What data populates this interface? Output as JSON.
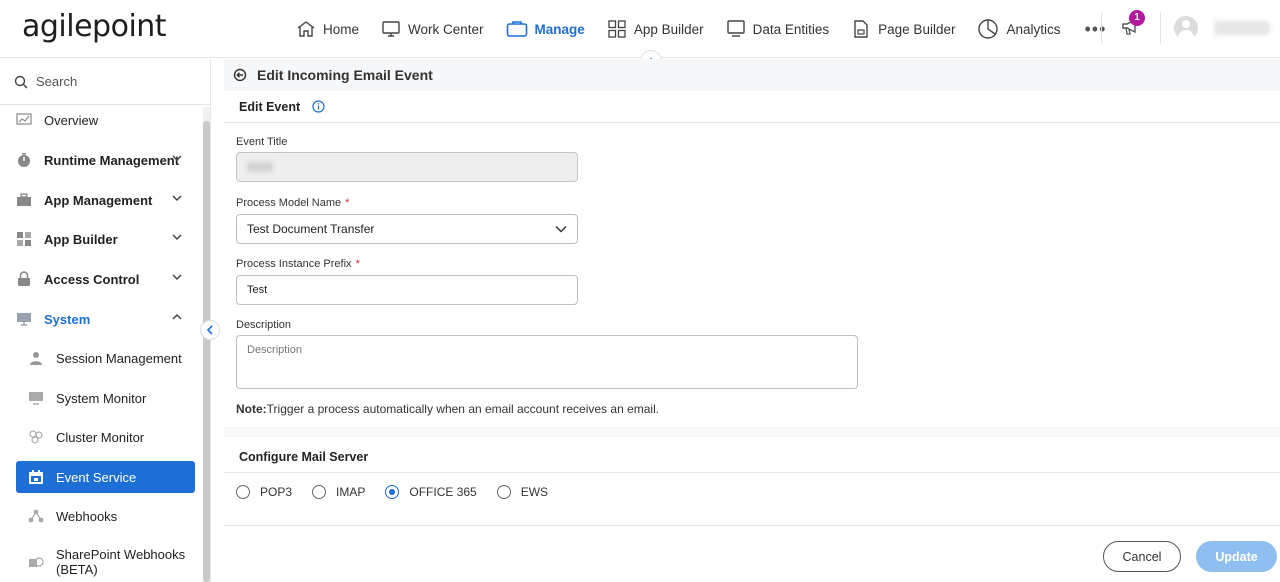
{
  "brand": {
    "logo_text": "agilepoint"
  },
  "nav": {
    "items": [
      {
        "label": "Home",
        "icon": "home-icon"
      },
      {
        "label": "Work Center",
        "icon": "monitor-icon"
      },
      {
        "label": "Manage",
        "icon": "briefcase-icon",
        "active": true
      },
      {
        "label": "App Builder",
        "icon": "grid-icon"
      },
      {
        "label": "Data Entities",
        "icon": "monitor-icon"
      },
      {
        "label": "Page Builder",
        "icon": "page-icon"
      },
      {
        "label": "Analytics",
        "icon": "pie-chart-icon"
      }
    ],
    "more_label": "•••",
    "notification_count": "1",
    "username": "developer"
  },
  "sidebar": {
    "search_placeholder": "Search",
    "items": [
      {
        "label": "Overview",
        "icon": "chart-icon"
      },
      {
        "label": "Runtime Management",
        "icon": "timer-icon"
      },
      {
        "label": "App Management",
        "icon": "briefcase-icon"
      },
      {
        "label": "App Builder",
        "icon": "grid-icon"
      },
      {
        "label": "Access Control",
        "icon": "lock-icon"
      },
      {
        "label": "System",
        "icon": "monitor-icon"
      }
    ],
    "sub_items": [
      {
        "label": "Session Management",
        "icon": "user-icon"
      },
      {
        "label": "System Monitor",
        "icon": "monitor-icon"
      },
      {
        "label": "Cluster Monitor",
        "icon": "cluster-icon"
      },
      {
        "label": "Event Service",
        "icon": "calendar-icon",
        "active": true
      },
      {
        "label": "Webhooks",
        "icon": "webhook-icon"
      },
      {
        "label": "SharePoint Webhooks",
        "label2": "(BETA)",
        "icon": "sharepoint-icon"
      }
    ]
  },
  "page": {
    "title": "Edit Incoming Email Event",
    "section_edit": "Edit Event",
    "event_title_label": "Event Title",
    "event_title_value": "test",
    "process_model_label": "Process Model Name",
    "process_model_value": "Test Document Transfer",
    "prefix_label": "Process Instance Prefix",
    "prefix_value": "Test",
    "description_label": "Description",
    "description_placeholder": "Description",
    "note_bold": "Note:",
    "note_text": "Trigger a process automatically when an email account receives an email.",
    "required_mark": "*",
    "section_mail": "Configure Mail Server",
    "mail_options": [
      {
        "label": "POP3",
        "checked": false
      },
      {
        "label": "IMAP",
        "checked": false
      },
      {
        "label": "OFFICE 365",
        "checked": true
      },
      {
        "label": "EWS",
        "checked": false
      }
    ],
    "cancel_label": "Cancel",
    "update_label": "Update"
  }
}
